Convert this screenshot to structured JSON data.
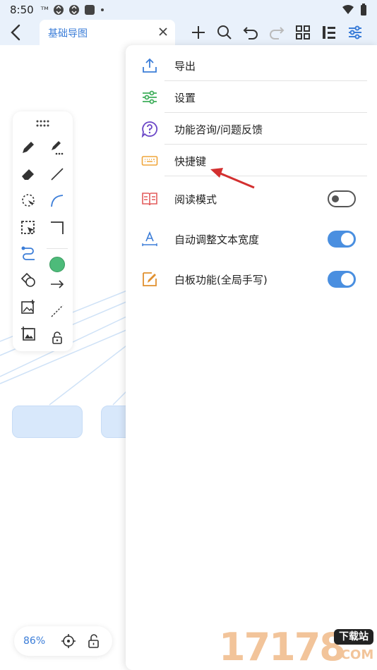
{
  "status_bar": {
    "time": "8:50",
    "carrier": "ᵀᴹ"
  },
  "header": {
    "back": "back-arrow-icon",
    "tab_label": "基础导图",
    "tab_close": "close-icon",
    "tools": [
      "add-icon",
      "search-icon",
      "undo-icon",
      "redo-icon",
      "grid-icon",
      "outline-icon",
      "settings-sliders-icon"
    ]
  },
  "menu": {
    "items": [
      {
        "label": "导出",
        "icon": "export-icon",
        "icon_color": "#3b7dd8"
      },
      {
        "label": "设置",
        "icon": "sliders-icon",
        "icon_color": "#3fae5b"
      },
      {
        "label": "功能咨询/问题反馈",
        "icon": "help-icon",
        "icon_color": "#6b47c7"
      },
      {
        "label": "快捷键",
        "icon": "keyboard-icon",
        "icon_color": "#f0a53a"
      },
      {
        "label": "阅读模式",
        "icon": "book-icon",
        "icon_color": "#e35b5b",
        "toggle": false
      },
      {
        "label": "自动调整文本宽度",
        "icon": "text-width-icon",
        "icon_color": "#3b7dd8",
        "toggle": true
      },
      {
        "label": "白板功能(全局手写)",
        "icon": "whiteboard-pen-icon",
        "icon_color": "#e0902f",
        "toggle": true
      }
    ]
  },
  "draw_toolbar": {
    "tools": [
      "pen-icon",
      "pen-dotted-icon",
      "eraser-icon",
      "line-icon",
      "lasso-icon",
      "arc-icon",
      "select-icon",
      "corner-icon",
      "connector-icon",
      "color-circle",
      "shapes-icon",
      "arrow-icon",
      "image-add-icon",
      "dashed-line-icon",
      "image-frame-icon",
      "lock-icon"
    ],
    "selected_color": "#4dbb7a"
  },
  "zoom_bar": {
    "zoom": "86%"
  },
  "watermark": {
    "number": "17178",
    "badge": "下载站",
    "domain": ".COM"
  },
  "colors": {
    "accent": "#3b7dd8",
    "toggle_on": "#4a8fe0"
  }
}
